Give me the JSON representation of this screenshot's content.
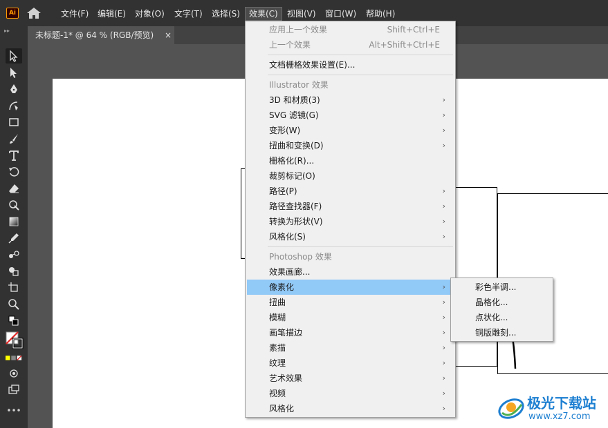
{
  "menubar": {
    "app_logo_text": "Ai",
    "home_icon": "home-icon",
    "items": [
      "文件(F)",
      "编辑(E)",
      "对象(O)",
      "文字(T)",
      "选择(S)",
      "效果(C)",
      "视图(V)",
      "窗口(W)",
      "帮助(H)"
    ],
    "active_item": "效果(C)"
  },
  "document_tab": {
    "title": "未标题-1* @ 64 % (RGB/预览)",
    "close_label": "×"
  },
  "toolbar": {
    "grip": "▸▸",
    "tools": [
      "selection-tool-icon",
      "direct-selection-tool-icon",
      "pen-tool-icon",
      "curvature-tool-icon",
      "rectangle-tool-icon",
      "paintbrush-tool-icon",
      "type-tool-icon",
      "rotate-tool-icon",
      "eraser-tool-icon",
      "warp-tool-icon",
      "gradient-tool-icon",
      "eyedropper-tool-icon",
      "blend-tool-icon",
      "shape-builder-tool-icon",
      "artboard-tool-icon",
      "zoom-tool-icon"
    ],
    "more_label": "•••"
  },
  "effect_menu": {
    "apply_last": {
      "label": "应用上一个效果",
      "shortcut": "Shift+Ctrl+E"
    },
    "last_effect": {
      "label": "上一个效果",
      "shortcut": "Alt+Shift+Ctrl+E"
    },
    "raster_settings": "文档栅格效果设置(E)...",
    "illustrator_header": "Illustrator 效果",
    "illustrator_items": [
      "3D 和材质(3)",
      "SVG 滤镜(G)",
      "变形(W)",
      "扭曲和变换(D)",
      "栅格化(R)...",
      "裁剪标记(O)",
      "路径(P)",
      "路径查找器(F)",
      "转换为形状(V)",
      "风格化(S)"
    ],
    "photoshop_header": "Photoshop 效果",
    "photoshop_items": [
      "效果画廊...",
      "像素化",
      "扭曲",
      "模糊",
      "画笔描边",
      "素描",
      "纹理",
      "艺术效果",
      "视频",
      "风格化"
    ],
    "highlighted": "像素化",
    "arrow_glyph": "›"
  },
  "pixelate_submenu": {
    "items": [
      "彩色半调...",
      "晶格化...",
      "点状化...",
      "铜版雕刻..."
    ]
  },
  "watermark": {
    "text": "极光下载站",
    "url": "www.xz7.com"
  },
  "colors": {
    "highlight": "#91c9f7",
    "menu_bg": "#f0f0f0",
    "chrome_dark": "#323232",
    "workspace": "#535353",
    "ai_orange": "#ff9a00"
  }
}
